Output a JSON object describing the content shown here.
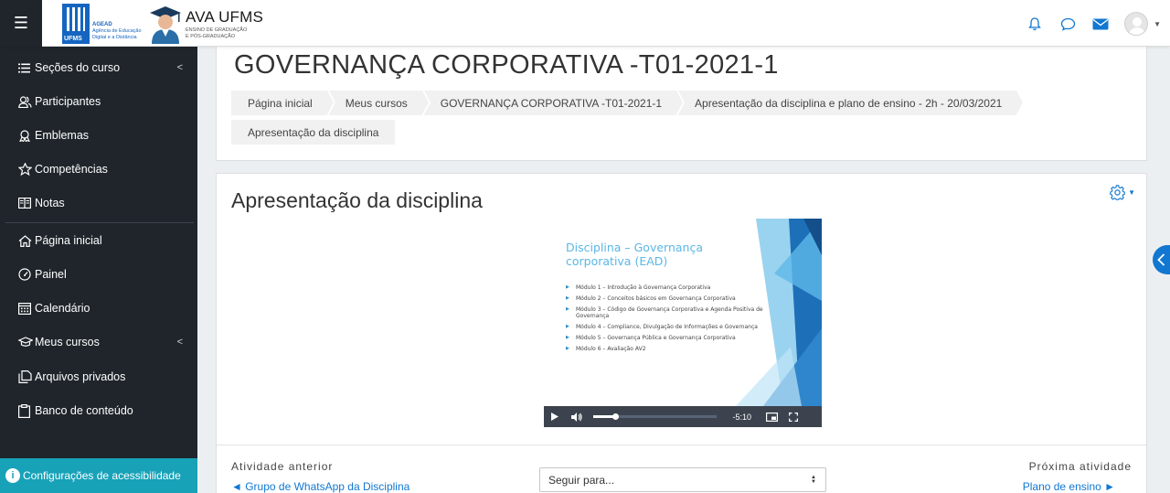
{
  "navbar": {
    "brand_title": "AVA UFMS",
    "brand_sub_1": "ENSINO DE GRADUAÇÃO",
    "brand_sub_2": "E PÓS-GRADUAÇÃO",
    "logo_agead": "AGEAD",
    "logo_agead_sub_1": "Agência de Educação",
    "logo_agead_sub_2": "Digital e a Distância",
    "logo_ufms": "UFMS",
    "icons": [
      "bell-icon",
      "chat-icon",
      "envelope-icon"
    ],
    "accent": "#1177d1"
  },
  "sidebar": {
    "items": [
      {
        "label": "Seções do curso",
        "icon": "list-icon"
      },
      {
        "label": "Participantes",
        "icon": "users-icon"
      },
      {
        "label": "Emblemas",
        "icon": "badge-icon"
      },
      {
        "label": "Competências",
        "icon": "star-icon"
      },
      {
        "label": "Notas",
        "icon": "grades-icon"
      },
      {
        "label": "Página inicial",
        "icon": "home-icon"
      },
      {
        "label": "Painel",
        "icon": "dashboard-icon"
      },
      {
        "label": "Calendário",
        "icon": "calendar-icon"
      },
      {
        "label": "Meus cursos",
        "icon": "graduation-cap-icon"
      },
      {
        "label": "Arquivos privados",
        "icon": "files-icon"
      },
      {
        "label": "Banco de conteúdo",
        "icon": "clipboard-icon"
      }
    ],
    "accessibility": "Configurações de acessibilidade",
    "bg": "#1f252b",
    "accessibility_bg": "#17a2b8"
  },
  "header": {
    "course_title": "GOVERNANÇA CORPORATIVA -T01-2021-1",
    "breadcrumbs": [
      "Página inicial",
      "Meus cursos",
      "GOVERNANÇA CORPORATIVA -T01-2021-1",
      "Apresentação da disciplina e plano de ensino - 2h - 20/03/2021"
    ],
    "breadcrumb_current": "Apresentação da disciplina"
  },
  "main": {
    "page_heading": "Apresentação da disciplina",
    "video": {
      "slide_title": "Disciplina – Governança corporativa (EAD)",
      "modules": [
        "Módulo 1 – Introdução à Governança Corporativa",
        "Módulo 2 – Conceitos básicos em Governança Corporativa",
        "Módulo 3 – Código de Governança Corporativa e Agenda Positiva de Governança",
        "Módulo 4 – Compliance, Divulgação de Informações e Governança",
        "Módulo 5 – Governança Pública e Governança Corporativa",
        "Módulo 6 – Avaliação AV2"
      ],
      "time_remaining": "-5:10",
      "progress": 0.18
    },
    "prev_label": "Atividade anterior",
    "prev_link": "◄ Grupo de WhatsApp da Disciplina",
    "jump_placeholder": "Seguir para...",
    "next_label": "Próxima atividade",
    "next_link": "Plano de ensino ►"
  }
}
